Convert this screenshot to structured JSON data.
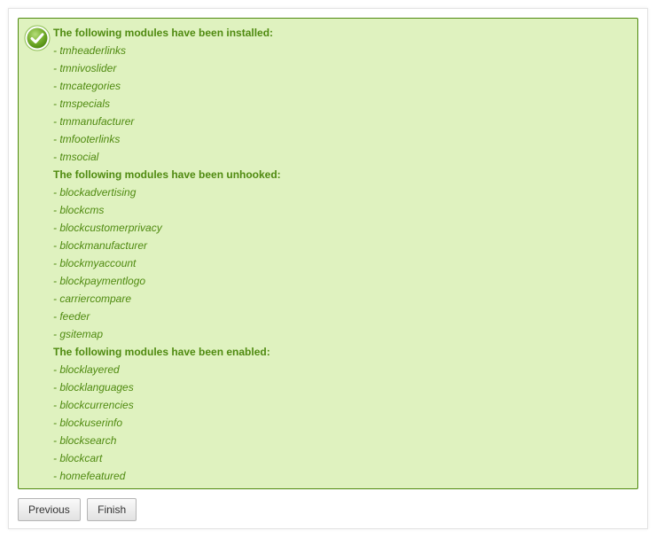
{
  "sections": [
    {
      "heading": "The following modules have been installed:",
      "items": [
        "- tmheaderlinks",
        "- tmnivoslider",
        "- tmcategories",
        "- tmspecials",
        "- tmmanufacturer",
        "- tmfooterlinks",
        "- tmsocial"
      ]
    },
    {
      "heading": "The following modules have been unhooked:",
      "items": [
        "- blockadvertising",
        "- blockcms",
        "- blockcustomerprivacy",
        "- blockmanufacturer",
        "- blockmyaccount",
        "- blockpaymentlogo",
        "- carriercompare",
        "- feeder",
        "- gsitemap"
      ]
    },
    {
      "heading": "The following modules have been enabled:",
      "items": [
        "- blocklayered",
        "- blocklanguages",
        "- blockcurrencies",
        "- blockuserinfo",
        "- blocksearch",
        "- blockcart",
        "- homefeatured"
      ]
    }
  ],
  "icon": "check-circle-icon",
  "colors": {
    "success_bg": "#dff2bf",
    "success_text": "#4f8a10",
    "success_border": "#4f8a10"
  },
  "buttons": {
    "previous_label": "Previous",
    "finish_label": "Finish"
  }
}
